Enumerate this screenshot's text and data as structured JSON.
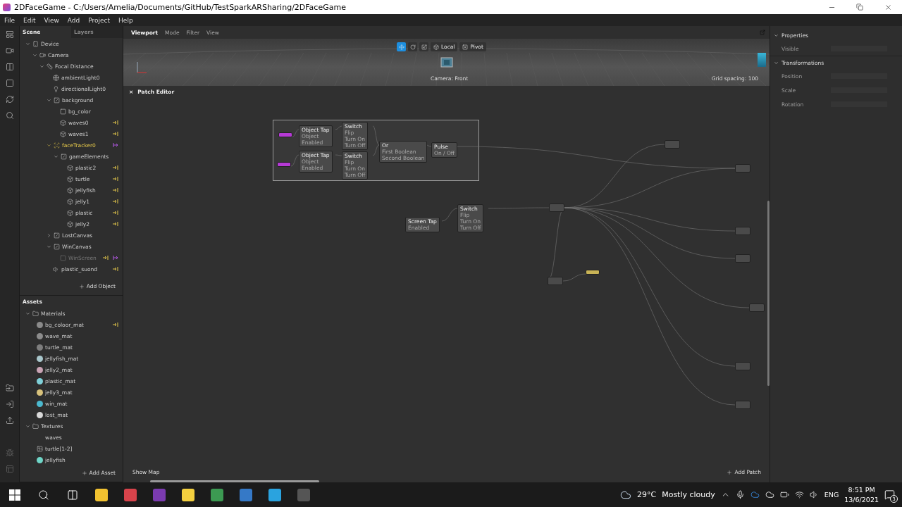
{
  "window": {
    "title": "2DFaceGame - C:/Users/Amelia/Documents/GitHub/TestSparkARSharing/2DFaceGame"
  },
  "menu": [
    "File",
    "Edit",
    "View",
    "Add",
    "Project",
    "Help"
  ],
  "scene": {
    "tabs": [
      {
        "label": "Scene",
        "selected": true
      },
      {
        "label": "Layers",
        "selected": false
      }
    ],
    "tree": [
      {
        "label": "Device",
        "kind": "device",
        "expanded": true,
        "disabled": false,
        "patch_input": false,
        "patch_output": false,
        "children": [
          {
            "label": "Camera",
            "kind": "camera",
            "expanded": true,
            "disabled": false,
            "patch_input": false,
            "patch_output": false,
            "children": [
              {
                "label": "Focal Distance",
                "kind": "focal",
                "expanded": true,
                "disabled": false,
                "patch_input": false,
                "patch_output": false,
                "children": [
                  {
                    "label": "ambientLight0",
                    "kind": "ambient",
                    "disabled": false,
                    "patch_input": false,
                    "patch_output": false
                  },
                  {
                    "label": "directionalLight0",
                    "kind": "directional",
                    "disabled": false,
                    "patch_input": false,
                    "patch_output": false
                  },
                  {
                    "label": "background",
                    "kind": "canvas",
                    "expanded": true,
                    "disabled": false,
                    "patch_input": false,
                    "patch_output": false,
                    "children": [
                      {
                        "label": "bg_color",
                        "kind": "rect",
                        "disabled": false,
                        "patch_input": false,
                        "patch_output": false
                      },
                      {
                        "label": "waves0",
                        "kind": "plane",
                        "disabled": false,
                        "patch_input": true,
                        "patch_output": false
                      },
                      {
                        "label": "waves1",
                        "kind": "plane",
                        "disabled": false,
                        "patch_input": true,
                        "patch_output": false
                      }
                    ]
                  },
                  {
                    "label": "faceTracker0",
                    "kind": "tracker",
                    "expanded": true,
                    "disabled": false,
                    "patch_input": false,
                    "patch_output": true,
                    "children": [
                      {
                        "label": "gameElements",
                        "kind": "canvas",
                        "expanded": true,
                        "disabled": false,
                        "patch_input": false,
                        "patch_output": false,
                        "children": [
                          {
                            "label": "plastic2",
                            "kind": "plane",
                            "disabled": false,
                            "patch_input": true,
                            "patch_output": false
                          },
                          {
                            "label": "turtle",
                            "kind": "plane",
                            "disabled": false,
                            "patch_input": true,
                            "patch_output": false
                          },
                          {
                            "label": "jellyfish",
                            "kind": "plane",
                            "disabled": false,
                            "patch_input": true,
                            "patch_output": false
                          },
                          {
                            "label": "jelly1",
                            "kind": "plane",
                            "disabled": false,
                            "patch_input": true,
                            "patch_output": false
                          },
                          {
                            "label": "plastic",
                            "kind": "plane",
                            "disabled": false,
                            "patch_input": true,
                            "patch_output": false
                          },
                          {
                            "label": "jelly2",
                            "kind": "plane",
                            "disabled": false,
                            "patch_input": true,
                            "patch_output": false
                          }
                        ]
                      }
                    ]
                  },
                  {
                    "label": "LostCanvas",
                    "kind": "canvas",
                    "expanded": false,
                    "disabled": false,
                    "patch_input": false,
                    "patch_output": false
                  },
                  {
                    "label": "WinCanvas",
                    "kind": "canvas",
                    "expanded": true,
                    "disabled": false,
                    "patch_input": false,
                    "patch_output": false,
                    "children": [
                      {
                        "label": "WinScreen",
                        "kind": "rect",
                        "disabled": true,
                        "patch_input": true,
                        "patch_output": true
                      }
                    ]
                  },
                  {
                    "label": "plastic_suond",
                    "kind": "sound",
                    "disabled": false,
                    "patch_input": true,
                    "patch_output": false
                  }
                ]
              }
            ]
          }
        ]
      }
    ],
    "add_button": "Add Object"
  },
  "assets": {
    "title": "Assets",
    "folders": [
      {
        "label": "Materials",
        "expanded": true,
        "items": [
          {
            "label": "bg_coloor_mat",
            "kind": "material",
            "color": "#8a8a8a",
            "patch_input": true
          },
          {
            "label": "wave_mat",
            "kind": "material",
            "color": "#8c8c8c",
            "patch_input": false
          },
          {
            "label": "turtle_mat",
            "kind": "material",
            "color": "#7e7e7e",
            "patch_input": false
          },
          {
            "label": "jellyfish_mat",
            "kind": "material",
            "color": "#a9c7cc",
            "patch_input": false
          },
          {
            "label": "jelly2_mat",
            "kind": "material",
            "color": "#c9a3b4",
            "patch_input": false
          },
          {
            "label": "plastic_mat",
            "kind": "material",
            "color": "#7fd0d8",
            "patch_input": false
          },
          {
            "label": "jelly3_mat",
            "kind": "material",
            "color": "#d8c27c",
            "patch_input": false
          },
          {
            "label": "win_mat",
            "kind": "material",
            "color": "#4bb9cf",
            "patch_input": false
          },
          {
            "label": "lost_mat",
            "kind": "material",
            "color": "#d9d9d9",
            "patch_input": false
          }
        ]
      },
      {
        "label": "Textures",
        "expanded": true,
        "items": [
          {
            "label": "waves",
            "kind": "blank",
            "patch_input": false
          },
          {
            "label": "turtle[1-2]",
            "kind": "image",
            "patch_input": false
          },
          {
            "label": "jellyfish",
            "kind": "jelly",
            "patch_input": false
          }
        ]
      }
    ],
    "add_button": "Add Asset"
  },
  "viewport": {
    "tabs": [
      {
        "label": "Viewport",
        "selected": true
      },
      {
        "label": "Mode",
        "selected": false
      },
      {
        "label": "Filter",
        "selected": false
      },
      {
        "label": "View",
        "selected": false
      }
    ],
    "tools": [
      {
        "kind": "move",
        "selected": true
      },
      {
        "kind": "rotate",
        "selected": false
      },
      {
        "kind": "scale",
        "selected": false
      }
    ],
    "space": "Local",
    "pivot": "Pivot",
    "camera_label": "Camera: Front",
    "grid_label": "Grid spacing: 100"
  },
  "patch_editor": {
    "close": "×",
    "title": "Patch Editor",
    "nodes": [
      {
        "kind": "purple"
      },
      {
        "kind": "purple"
      },
      {
        "kind": "node",
        "title": "Object Tap",
        "ports": [
          "Object",
          "Enabled"
        ]
      },
      {
        "kind": "node",
        "title": "Object Tap",
        "ports": [
          "Object",
          "Enabled"
        ]
      },
      {
        "kind": "node",
        "title": "Switch",
        "ports": [
          "Flip",
          "Turn On",
          "Turn Off"
        ]
      },
      {
        "kind": "node",
        "title": "Switch",
        "ports": [
          "Flip",
          "Turn On",
          "Turn Off"
        ]
      },
      {
        "kind": "node",
        "title": "Or",
        "ports": [
          "First Boolean",
          "Second Boolean"
        ]
      },
      {
        "kind": "node",
        "title": "Pulse",
        "ports": [
          "On / Off"
        ]
      },
      {
        "kind": "node"
      },
      {
        "kind": "node",
        "title": "Screen Tap",
        "ports": [
          "Enabled"
        ]
      },
      {
        "kind": "node",
        "title": "Switch",
        "ports": [
          "Flip",
          "Turn On",
          "Turn Off"
        ]
      },
      {
        "kind": "node"
      },
      {
        "kind": "node"
      },
      {
        "kind": "yellow"
      },
      {
        "kind": "node"
      },
      {
        "kind": "node"
      },
      {
        "kind": "node"
      },
      {
        "kind": "node"
      },
      {
        "kind": "node"
      },
      {
        "kind": "node"
      }
    ],
    "show_map": "Show Map",
    "add_button": "Add Patch"
  },
  "properties": {
    "sections": [
      {
        "title": "Properties",
        "expanded": true,
        "rows": [
          "Visible"
        ]
      },
      {
        "title": "Transformations",
        "expanded": true,
        "rows": [
          "Position",
          "Scale",
          "Rotation"
        ]
      }
    ]
  },
  "taskbar": {
    "temperature": "29°C",
    "weather": "Mostly cloudy",
    "language": "ENG",
    "time": "8:51 PM",
    "date": "13/6/2021",
    "notifications": "3"
  }
}
